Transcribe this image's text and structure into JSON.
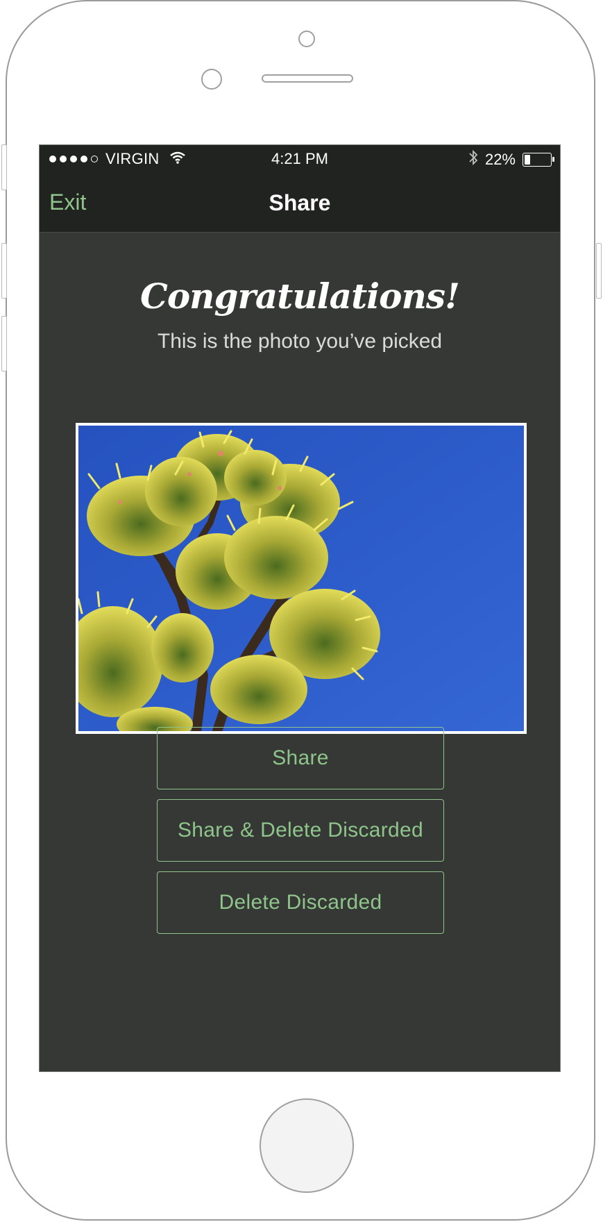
{
  "statusbar": {
    "signal_dots_filled": 4,
    "signal_dots_total": 5,
    "carrier": "VIRGIN",
    "wifi_icon": "wifi-icon",
    "time": "4:21 PM",
    "bluetooth_icon": "bluetooth-icon",
    "battery_percent_label": "22%",
    "battery_level": 0.22
  },
  "navbar": {
    "exit_label": "Exit",
    "title": "Share"
  },
  "main": {
    "heading": "Congratulations!",
    "subtitle": "This is the photo you’ve picked",
    "photo": {
      "subject": "yellow-flowering-agave-branches-against-blue-sky",
      "colors": {
        "sky": "#2f5fc7",
        "flower": "#d9d14f",
        "stem": "#3a2b1f"
      }
    },
    "buttons": [
      {
        "label": "Share"
      },
      {
        "label": "Share & Delete Discarded"
      },
      {
        "label": "Delete Discarded"
      }
    ]
  },
  "theme": {
    "accent": "#8fc48a",
    "background": "#353835",
    "bar_background": "#212321"
  }
}
